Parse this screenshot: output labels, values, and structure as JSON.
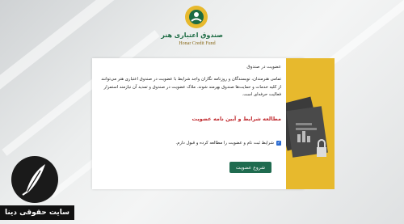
{
  "logo": {
    "title": "صندوق اعتباری هنر",
    "subtitle": "Honar Credit Fund"
  },
  "membership": {
    "heading": "عضویت در صندوق",
    "description": "تمامی هنرمندان، نویسندگان و روزنامه نگاران واجد شرایط با عضویت در صندوق اعتباری هنر می‌توانند از کلیه خدمات و حمایت‌ها صندوق بهرمند شوند. ملاک عضویت در صندوق و تمدید آن نیازمند استمرار فعالیت حرفه‌ای است.",
    "rules_link": "مطالعه شرایط و آیین نامه عضویت",
    "agree_label": "شرایط ثبت نام و عضویت را مطالعه کرده و قبول دارم.",
    "agree_checked": true,
    "start_button": "شروع عضویت"
  },
  "watermark": {
    "text": "سایت حقوقی دینا"
  },
  "colors": {
    "accent_yellow": "#e7b92d",
    "button_green": "#1f6b4f",
    "link_red": "#c0282d",
    "checkbox_blue": "#2b6bd1"
  }
}
